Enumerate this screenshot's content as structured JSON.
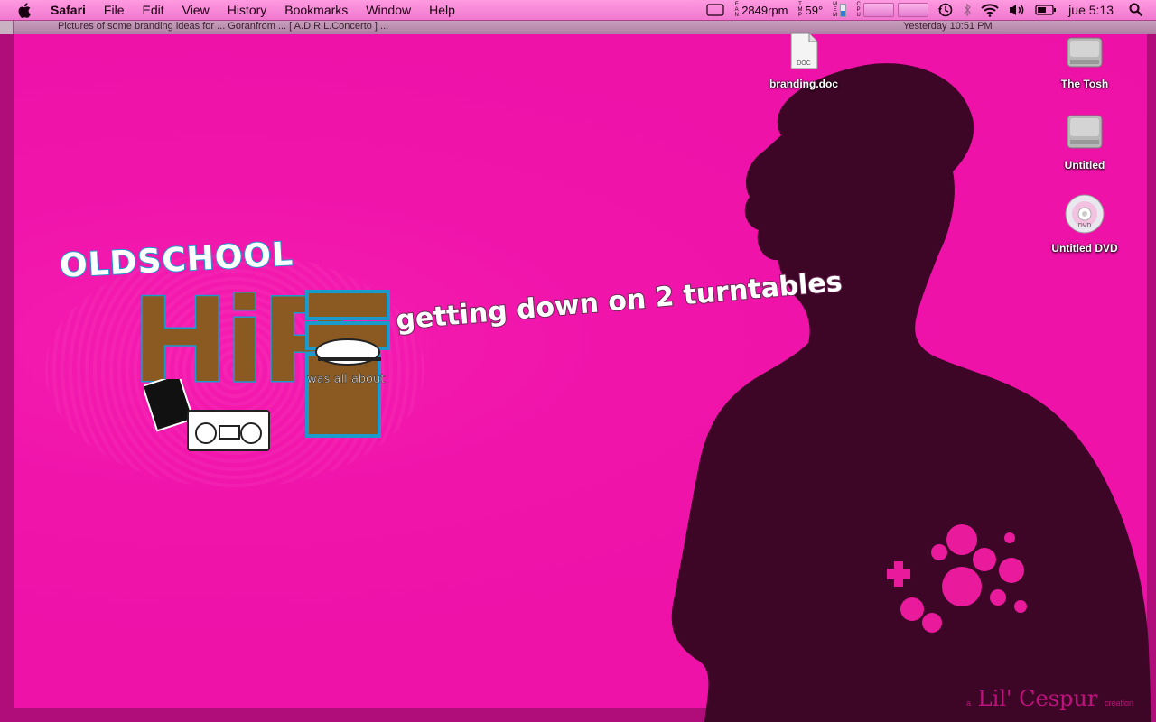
{
  "menubar": {
    "app_name": "Safari",
    "menus": [
      "File",
      "Edit",
      "View",
      "History",
      "Bookmarks",
      "Window",
      "Help"
    ],
    "status": {
      "fan_label": "FAN",
      "fan_speed": "2849rpm",
      "temp_label": "TMP",
      "temperature": "59°",
      "mem_label": "MEM",
      "cpu_label": "CPU",
      "clock": "jue 5:13"
    }
  },
  "background_window": {
    "title_left": "Pictures of some branding ideas for ...  Goranfrom ... [ A.D.R.L.Concerto ] ...",
    "title_right": "Yesterday 10:51 PM"
  },
  "desktop_icons": [
    {
      "label": "branding.doc",
      "icon": "doc-file-icon",
      "badge": "DOC"
    },
    {
      "label": "The Tosh",
      "icon": "hard-drive-icon"
    },
    {
      "label": "Untitled",
      "icon": "hard-drive-icon"
    },
    {
      "label": "Untitled DVD",
      "icon": "dvd-disc-icon",
      "badge": "DVD"
    }
  ],
  "wallpaper": {
    "line1": "OLDSCHOOL",
    "line2": "HiP",
    "line3": "was all about",
    "tagline": "getting down on 2 turntables",
    "signature": "Lil' Cespur",
    "signature_prefix": "a",
    "signature_suffix": "creation"
  },
  "colors": {
    "wallpaper": "#ee11a8",
    "silhouette": "#3d0526",
    "hip_fill": "#8a5a22",
    "outline": "#1a9bcc"
  }
}
